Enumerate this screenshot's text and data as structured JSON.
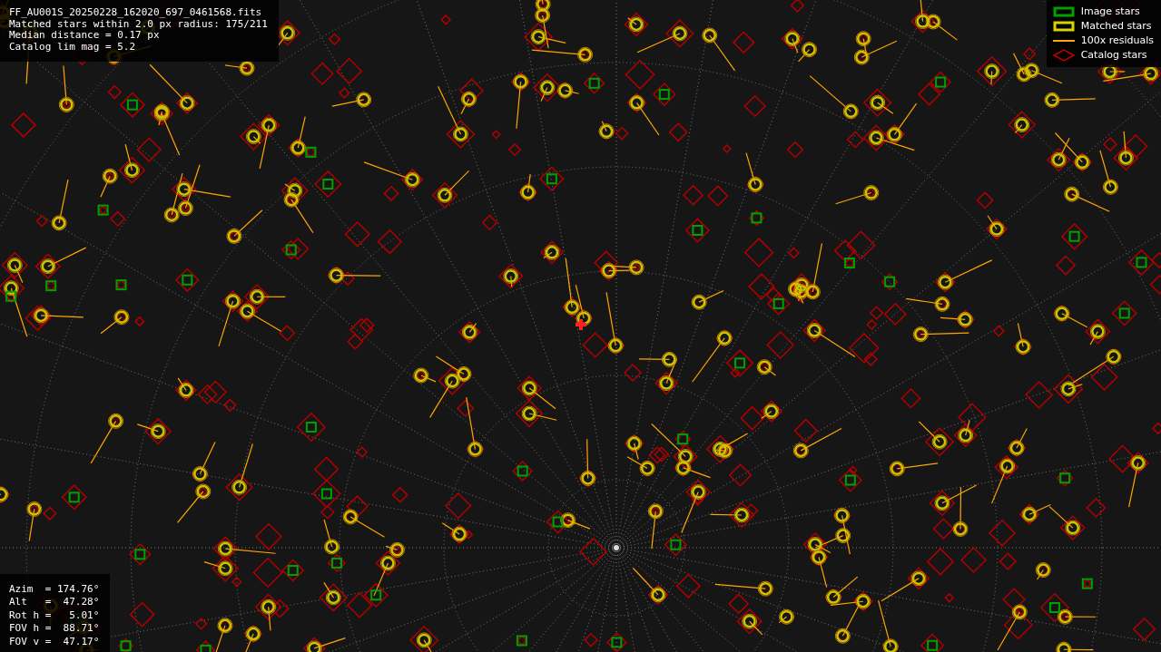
{
  "file_info": [
    "FF_AU001S_20250228_162020_697_0461568.fits",
    "Matched stars within 2.0 px radius: 175/211",
    "Median distance = 0.17 px",
    "Catalog lim mag = 5.2"
  ],
  "legend": [
    {
      "kind": "box",
      "color": "#00a000",
      "label": "Image stars"
    },
    {
      "kind": "box",
      "color": "#d4d400",
      "label": "Matched stars"
    },
    {
      "kind": "line",
      "color": "#ffa500",
      "label": "100x residuals"
    },
    {
      "kind": "diamond",
      "color": "#c00000",
      "label": "Catalog stars"
    }
  ],
  "pointing": [
    "Azim  = 174.76°",
    "Alt   =  47.28°",
    "Rot h =   5.01°",
    "FOV h =  88.71°",
    "FOV v =  47.17°"
  ]
}
